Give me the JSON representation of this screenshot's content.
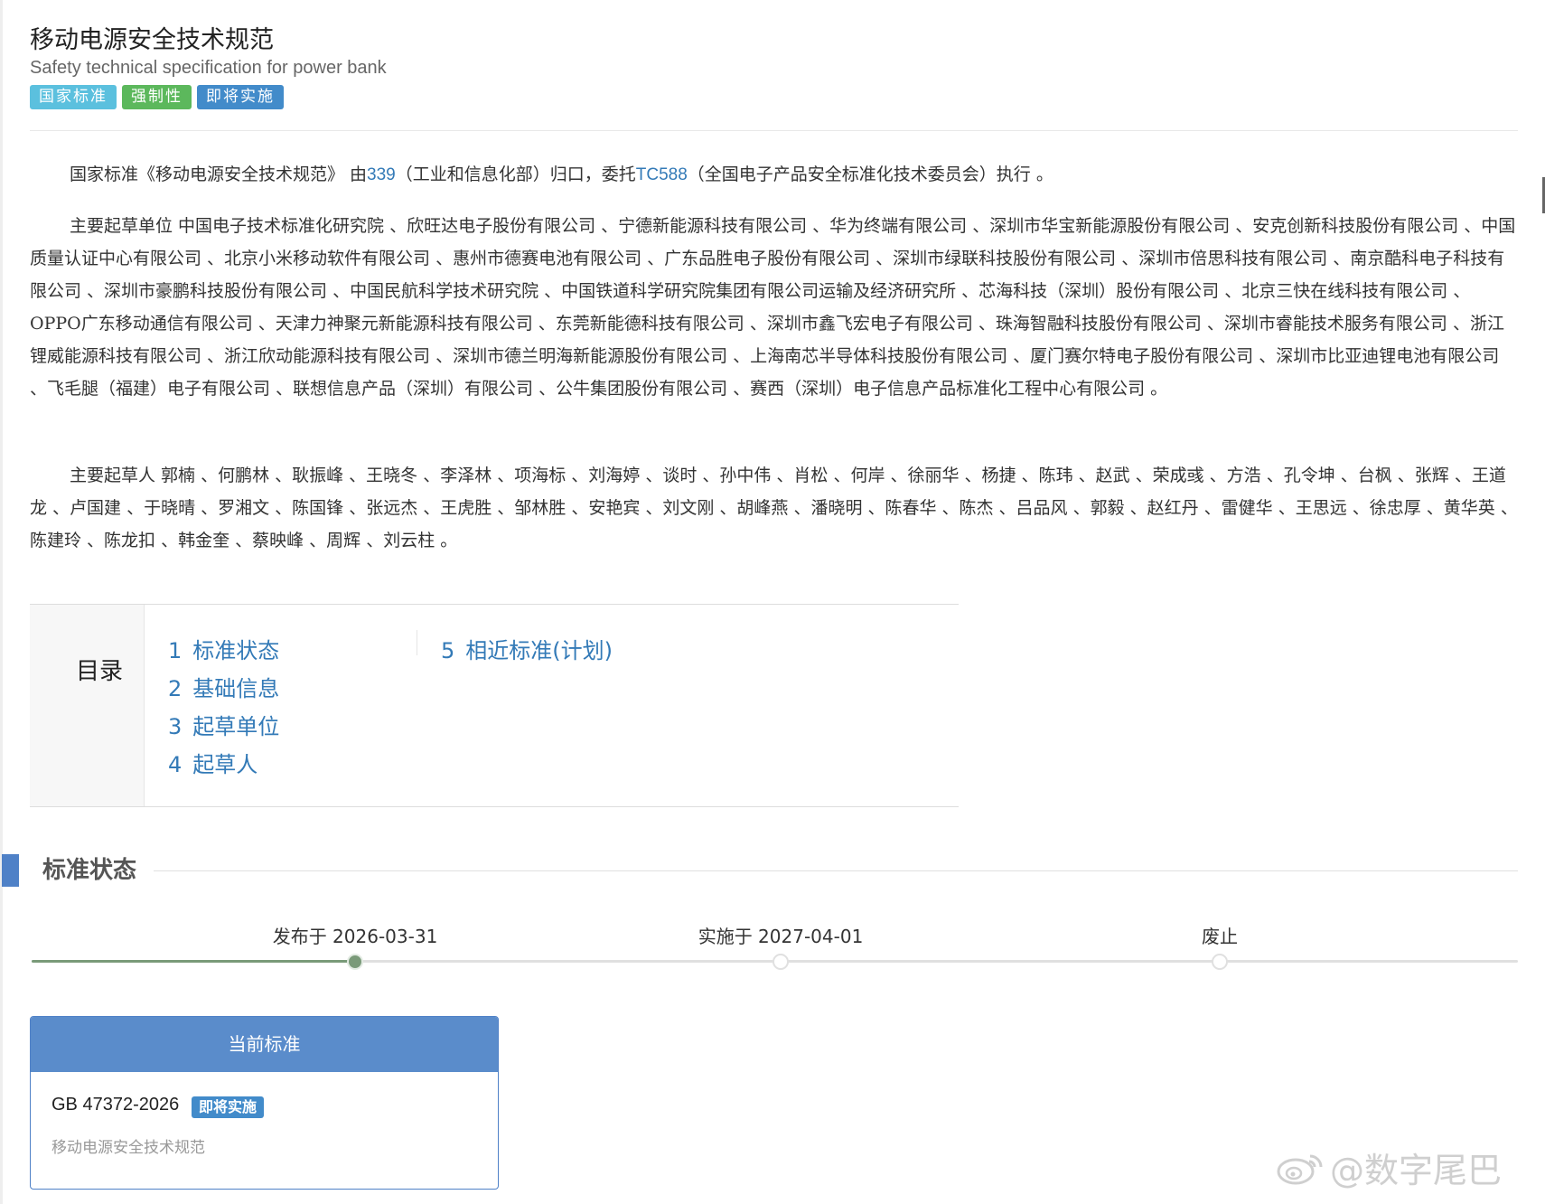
{
  "header": {
    "title": "移动电源安全技术规范",
    "subtitle": "Safety technical specification for power bank",
    "badges": [
      "国家标准",
      "强制性",
      "即将实施"
    ]
  },
  "intro": {
    "prefix": "国家标准《移动电源安全技术规范》 由",
    "dept_code": "339",
    "dept_mid": "（工业和信息化部）归口，委托",
    "tc_code": "TC588",
    "tc_suffix": "（全国电子产品安全标准化技术委员会）执行 。"
  },
  "drafting_units": "主要起草单位 中国电子技术标准化研究院 、欣旺达电子股份有限公司 、宁德新能源科技有限公司 、华为终端有限公司 、深圳市华宝新能源股份有限公司 、安克创新科技股份有限公司 、中国质量认证中心有限公司 、北京小米移动软件有限公司 、惠州市德赛电池有限公司 、广东品胜电子股份有限公司 、深圳市绿联科技股份有限公司 、深圳市倍思科技有限公司 、南京酷科电子科技有限公司 、深圳市豪鹏科技股份有限公司 、中国民航科学技术研究院 、中国铁道科学研究院集团有限公司运输及经济研究所 、芯海科技（深圳）股份有限公司 、北京三快在线科技有限公司 、OPPO广东移动通信有限公司 、天津力神聚元新能源科技有限公司 、东莞新能德科技有限公司 、深圳市鑫飞宏电子有限公司 、珠海智融科技股份有限公司 、深圳市睿能技术服务有限公司 、浙江锂威能源科技有限公司 、浙江欣动能源科技有限公司 、深圳市德兰明海新能源股份有限公司 、上海南芯半导体科技股份有限公司 、厦门赛尔特电子股份有限公司 、深圳市比亚迪锂电池有限公司 、飞毛腿（福建）电子有限公司 、联想信息产品（深圳）有限公司 、公牛集团股份有限公司 、赛西（深圳）电子信息产品标准化工程中心有限公司 。",
  "drafters": "主要起草人 郭楠 、何鹏林 、耿振峰 、王晓冬 、李泽林 、项海标 、刘海婷 、谈时 、孙中伟 、肖松 、何岸 、徐丽华 、杨捷 、陈玮 、赵武 、荣成彧 、方浩 、孔令坤 、台枫 、张辉 、王道龙 、卢国建 、于晓晴 、罗湘文 、陈国锋 、张远杰 、王虎胜 、邹林胜 、安艳宾 、刘文刚 、胡峰燕 、潘晓明 、陈春华 、陈杰 、吕品风 、郭毅 、赵红丹 、雷健华 、王思远 、徐忠厚 、黄华英 、陈建玲 、陈龙扣 、韩金奎 、蔡映峰 、周辉 、刘云柱 。",
  "toc": {
    "label": "目录",
    "items": [
      {
        "num": "1",
        "label": "标准状态"
      },
      {
        "num": "2",
        "label": "基础信息"
      },
      {
        "num": "3",
        "label": "起草单位"
      },
      {
        "num": "4",
        "label": "起草人"
      },
      {
        "num": "5",
        "label": "相近标准(计划)"
      }
    ]
  },
  "status_section": {
    "title": "标准状态",
    "timeline": [
      {
        "label": "发布于 2026-03-31",
        "reached": true
      },
      {
        "label": "实施于 2027-04-01",
        "reached": false
      },
      {
        "label": "废止",
        "reached": false
      }
    ]
  },
  "current_standard": {
    "header": "当前标准",
    "code": "GB 47372-2026",
    "badge": "即将实施",
    "name": "移动电源安全技术规范"
  },
  "watermark": {
    "icon": "weibo-icon",
    "text": "@数字尾巴"
  }
}
